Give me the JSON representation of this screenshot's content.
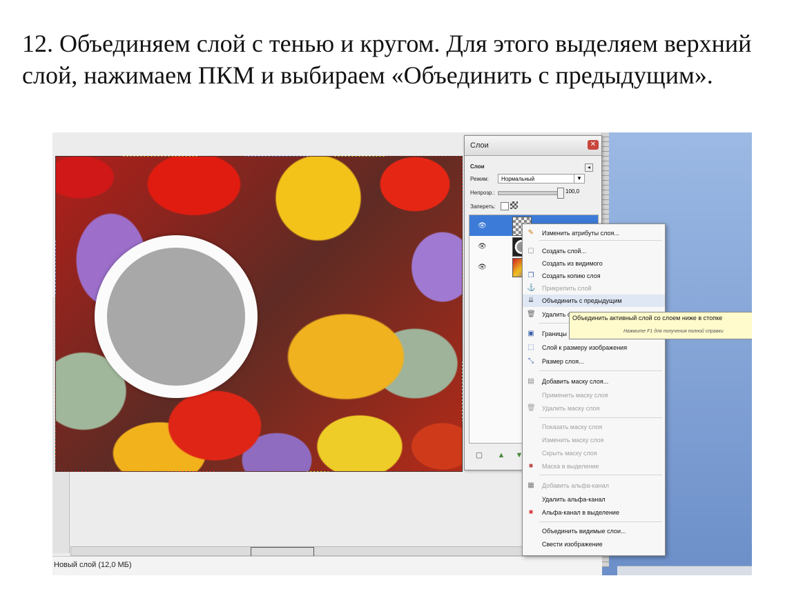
{
  "instruction": "12. Объединяем слой с тенью и кругом. Для этого выделяем верхний слой, нажимаем ПКМ и выбираем «Объединить с предыдущим».",
  "layers_panel": {
    "title": "Слои",
    "header": "Слои",
    "mode_label": "Режим:",
    "mode_value": "Нормальный",
    "opacity_label": "Непрозр.:",
    "opacity_value": "100,0",
    "lock_label": "Запереть:",
    "layers": [
      {
        "name": "Новый слой",
        "visible": true,
        "active": true
      },
      {
        "name": "",
        "visible": true,
        "active": false
      },
      {
        "name": "",
        "visible": true,
        "active": false
      }
    ]
  },
  "context_menu": {
    "items": [
      {
        "label": "Изменить атрибуты слоя...",
        "disabled": false,
        "icon": "edit-icon"
      },
      {
        "label": "Создать слой...",
        "disabled": false,
        "icon": "new-layer-icon"
      },
      {
        "label": "Создать из видимого",
        "disabled": false,
        "icon": ""
      },
      {
        "label": "Создать копию слоя",
        "disabled": false,
        "icon": "duplicate-icon"
      },
      {
        "label": "Прикрепить слой",
        "disabled": true,
        "icon": "anchor-icon"
      },
      {
        "label": "Объединить с предыдущим",
        "disabled": false,
        "icon": "merge-icon",
        "highlighted": true
      },
      {
        "label": "Удалить слой",
        "disabled": false,
        "icon": "trash-icon"
      },
      {
        "label": "Границы слоя...",
        "disabled": false,
        "icon": "boundary-icon"
      },
      {
        "label": "Слой к размеру изображения",
        "disabled": false,
        "icon": "fit-icon"
      },
      {
        "label": "Размер слоя...",
        "disabled": false,
        "icon": "scale-icon"
      },
      {
        "label": "Добавить маску слоя...",
        "disabled": false,
        "icon": "mask-icon"
      },
      {
        "label": "Применить маску слоя",
        "disabled": true,
        "icon": ""
      },
      {
        "label": "Удалить маску слоя",
        "disabled": true,
        "icon": "trash-icon"
      },
      {
        "label": "Показать маску слоя",
        "disabled": true,
        "icon": ""
      },
      {
        "label": "Изменить маску слоя",
        "disabled": true,
        "icon": ""
      },
      {
        "label": "Скрыть маску слоя",
        "disabled": true,
        "icon": ""
      },
      {
        "label": "Маска в выделение",
        "disabled": true,
        "icon": "mask-select-icon"
      },
      {
        "label": "Добавить альфа-канал",
        "disabled": true,
        "icon": "alpha-icon"
      },
      {
        "label": "Удалить альфа-канал",
        "disabled": false,
        "icon": ""
      },
      {
        "label": "Альфа-канал в выделение",
        "disabled": false,
        "icon": "alpha-select-icon"
      },
      {
        "label": "Объединить видимые слои...",
        "disabled": false,
        "icon": ""
      },
      {
        "label": "Свести изображение",
        "disabled": false,
        "icon": ""
      }
    ]
  },
  "tooltip": {
    "text": "Объединить активный слой со слоем ниже в стопке",
    "hint": "Нажмите F1 для получения полной справки"
  },
  "status": {
    "text": "Новый слой (12,0 МБ)"
  },
  "colors": {
    "selection_blue": "#3d7bd8",
    "desktop_blue": "#7d9fd6",
    "tooltip_yellow": "#fffbcc"
  }
}
